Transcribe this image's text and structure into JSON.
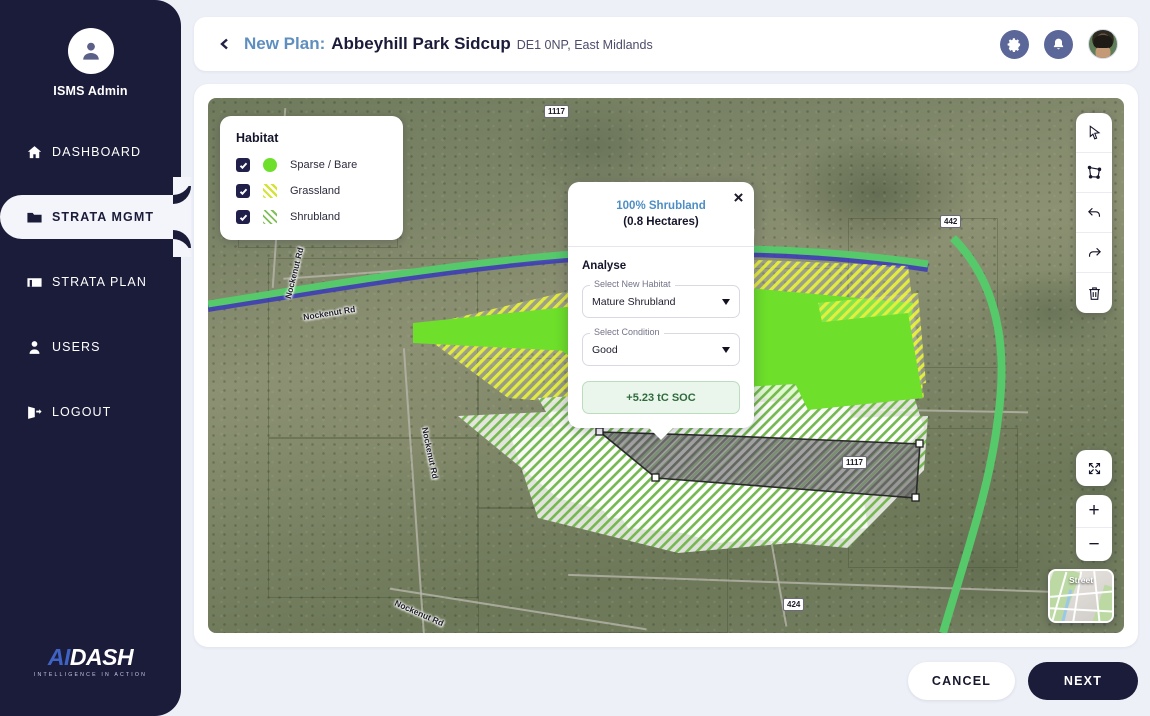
{
  "sidebar": {
    "user": {
      "name": "ISMS Admin",
      "avatar_icon": "person-icon"
    },
    "items": [
      {
        "label": "DASHBOARD",
        "icon": "home-icon",
        "active": false
      },
      {
        "label": "STRATA  MGMT",
        "icon": "folder-icon",
        "active": true
      },
      {
        "label": "STRATA PLAN",
        "icon": "plan-icon",
        "active": false
      },
      {
        "label": "USERS",
        "icon": "user-icon",
        "active": false
      },
      {
        "label": "LOGOUT",
        "icon": "logout-icon",
        "active": false
      }
    ],
    "brand": {
      "ai": "AI",
      "dash": "DASH",
      "tagline": "INTELLIGENCE IN ACTION"
    },
    "bg_color": "#1b1b3a"
  },
  "header": {
    "back_icon": "chevron-left-icon",
    "title_prefix": "New Plan:",
    "title": "Abbeyhill Park Sidcup",
    "subtitle": "DE1 0NP, East Midlands",
    "prefix_color": "#5e8fbf",
    "settings_icon": "gear-icon",
    "notifications_icon": "bell-icon",
    "profile_icon": "avatar"
  },
  "legend": {
    "title": "Habitat",
    "items": [
      {
        "label": "Sparse / Bare",
        "checked": true,
        "swatch": "dot",
        "color": "#6ee02b"
      },
      {
        "label": "Grassland",
        "checked": true,
        "swatch": "hatch",
        "color": "#d6e23a"
      },
      {
        "label": "Shrubland",
        "checked": true,
        "swatch": "hatch",
        "color": "#7fc05a"
      }
    ]
  },
  "popup": {
    "close_icon": "close-icon",
    "percent_label": "100% Shrubland",
    "area_label": "(0.8 Hectares)",
    "section_title": "Analyse",
    "fields": [
      {
        "label": "Select New Habitat",
        "value": "Mature Shrubland"
      },
      {
        "label": "Select Condition",
        "value": "Good"
      }
    ],
    "result": "+5.23 tC SOC",
    "result_color": "#2f6b3c"
  },
  "map_tools": {
    "buttons": [
      {
        "name": "select-cursor-tool",
        "icon": "cursor-icon"
      },
      {
        "name": "draw-polygon-tool",
        "icon": "polygon-icon"
      },
      {
        "name": "undo-tool",
        "icon": "undo-icon"
      },
      {
        "name": "redo-tool",
        "icon": "redo-icon"
      },
      {
        "name": "delete-tool",
        "icon": "trash-icon"
      }
    ],
    "fullscreen_icon": "expand-icon",
    "zoom_in": "+",
    "zoom_out": "−",
    "basemap_label": "Street"
  },
  "map_labels": {
    "roads": [
      "Nockenut Rd",
      "Nockenut Rd",
      "Nockenut Rd",
      "Nockenut Rd"
    ],
    "shields": [
      "1117",
      "442",
      "442",
      "1117",
      "424",
      "1117"
    ]
  },
  "footer": {
    "cancel": "CANCEL",
    "next": "NEXT"
  }
}
